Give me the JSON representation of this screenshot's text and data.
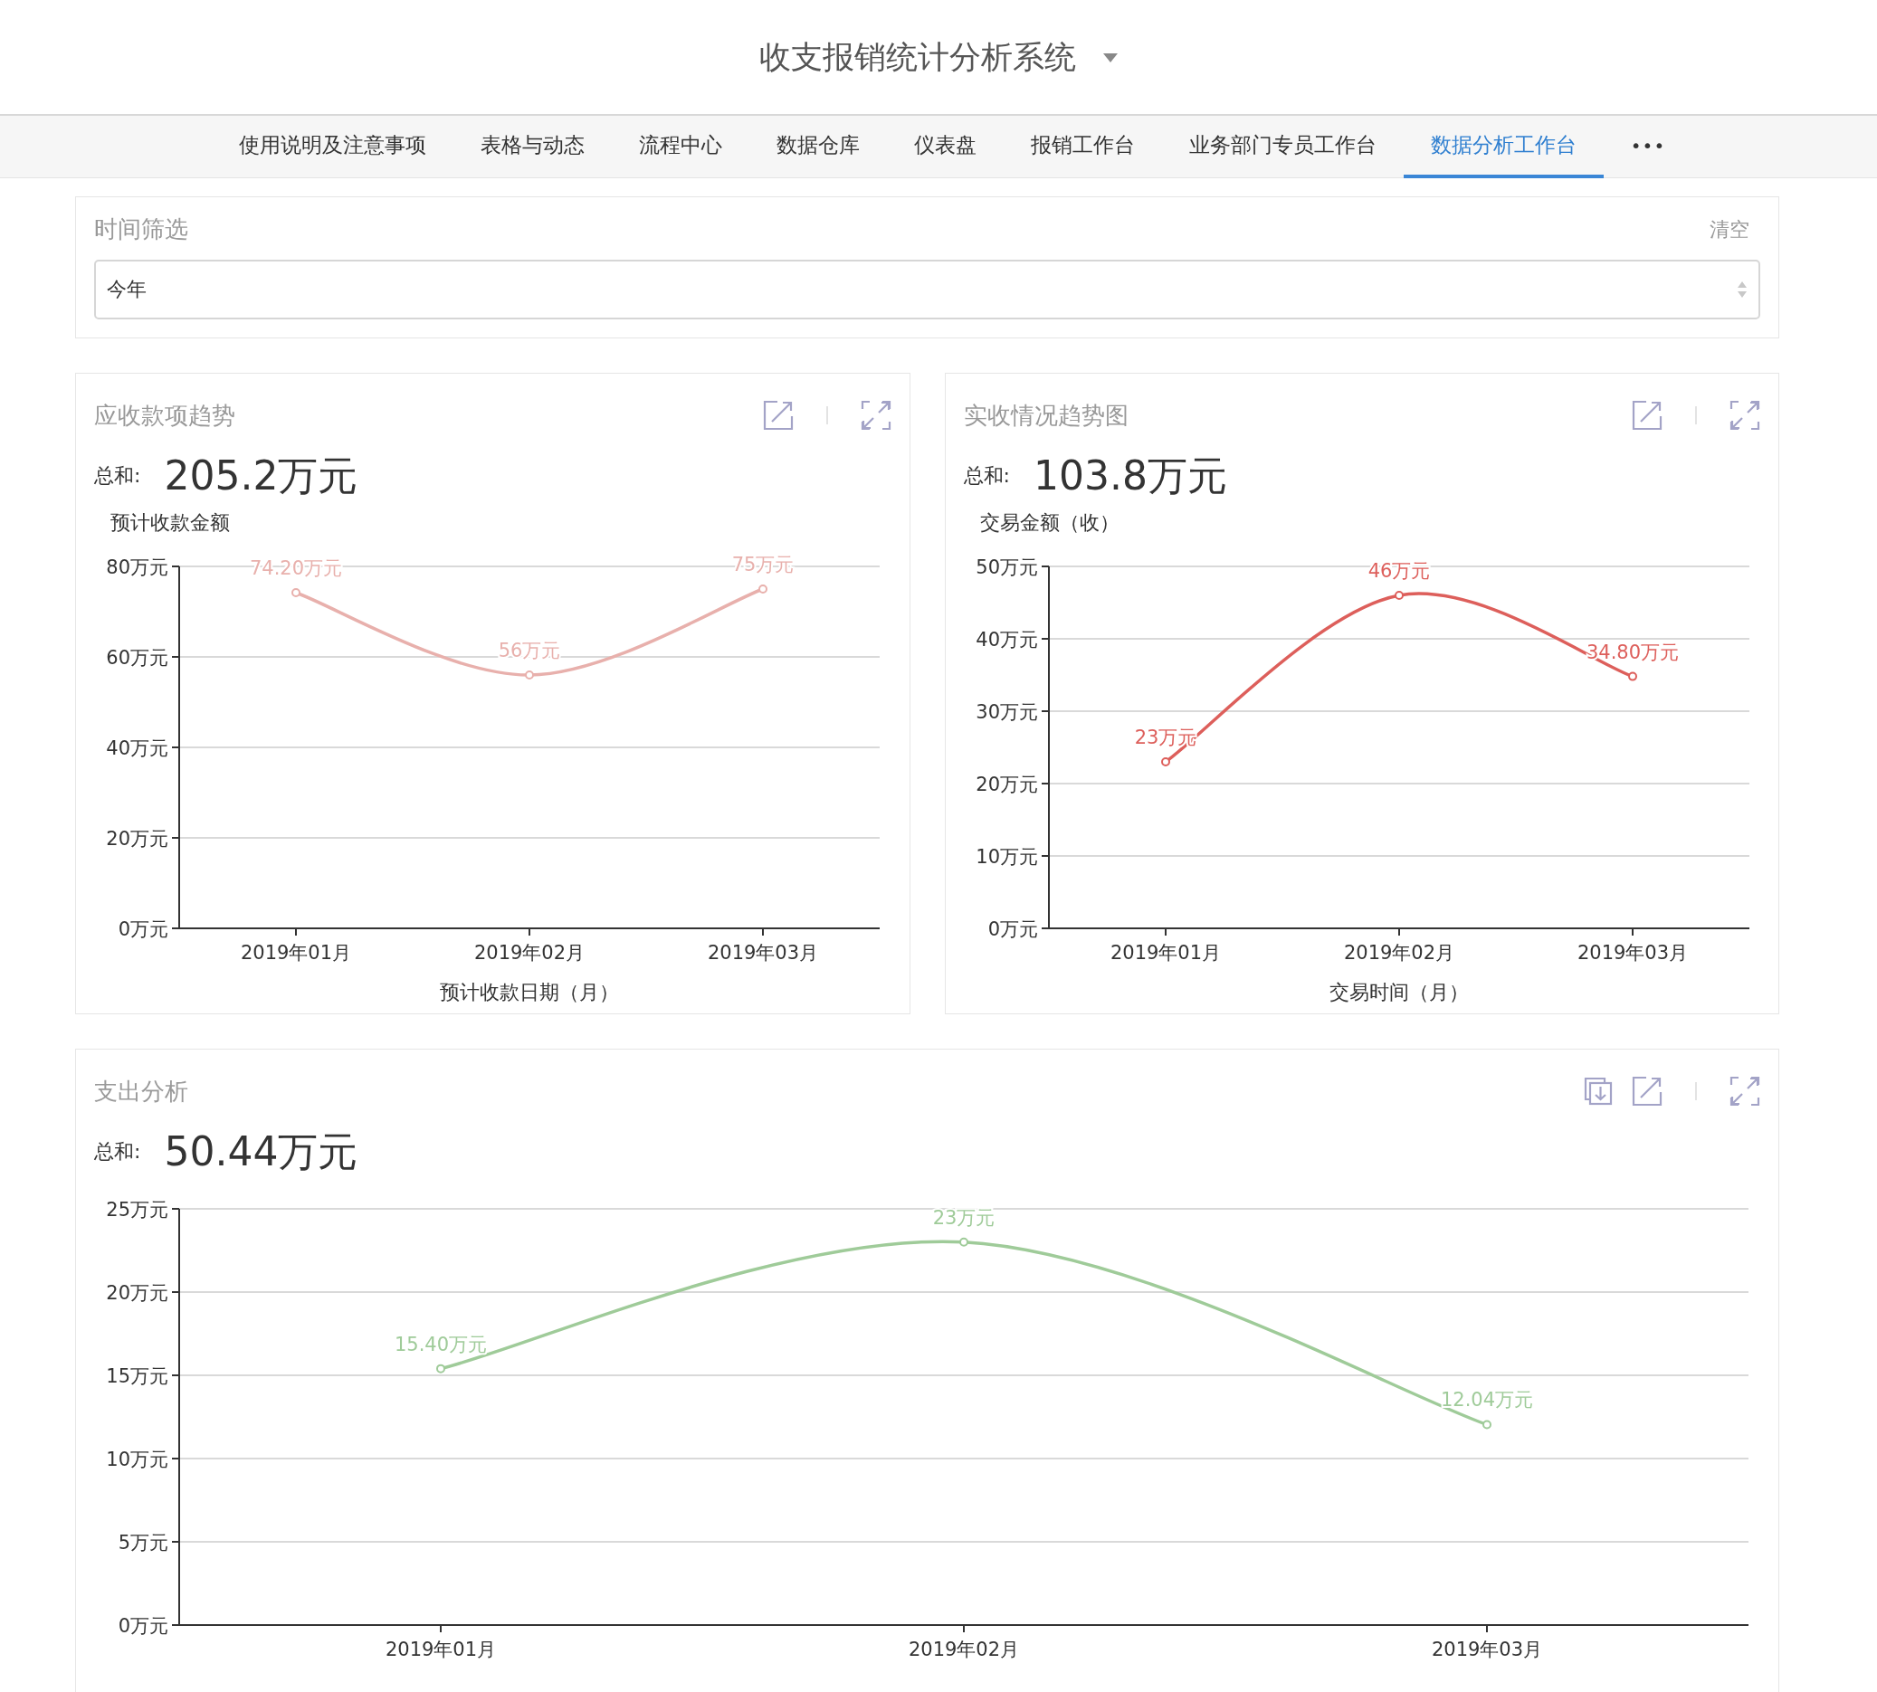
{
  "header": {
    "title": "收支报销统计分析系统"
  },
  "nav": {
    "tabs": [
      {
        "label": "使用说明及注意事项",
        "selected": false
      },
      {
        "label": "表格与动态",
        "selected": false
      },
      {
        "label": "流程中心",
        "selected": false
      },
      {
        "label": "数据仓库",
        "selected": false
      },
      {
        "label": "仪表盘",
        "selected": false
      },
      {
        "label": "报销工作台",
        "selected": false
      },
      {
        "label": "业务部门专员工作台",
        "selected": false
      },
      {
        "label": "数据分析工作台",
        "selected": true
      }
    ],
    "more": "•••"
  },
  "filter": {
    "title": "时间筛选",
    "clear": "清空",
    "value": "今年"
  },
  "panels": [
    {
      "title": "应收款项趋势",
      "wide": false,
      "download": false,
      "total_label": "总和:",
      "total": "205.2万元",
      "chart_data": {
        "type": "line",
        "ylabel": "预计收款金额",
        "xlabel": "预计收款日期（月）",
        "categories": [
          "2019年01月",
          "2019年02月",
          "2019年03月"
        ],
        "grid": true,
        "series": [
          {
            "color": "#e8b0ac",
            "marker": true,
            "values": [
              74.2,
              56,
              75
            ]
          }
        ],
        "value_labels": [
          "74.20万元",
          "56万元",
          "75万元"
        ],
        "ylim": [
          0,
          80
        ],
        "yticks": [
          {
            "value": 0,
            "label": "0万元"
          },
          {
            "value": 20,
            "label": "20万元"
          },
          {
            "value": 40,
            "label": "40万元"
          },
          {
            "value": 60,
            "label": "60万元"
          },
          {
            "value": 80,
            "label": "80万元"
          }
        ]
      }
    },
    {
      "title": "实收情况趋势图",
      "wide": false,
      "download": false,
      "total_label": "总和:",
      "total": "103.8万元",
      "chart_data": {
        "type": "line",
        "ylabel": "交易金额（收）",
        "xlabel": "交易时间（月）",
        "categories": [
          "2019年01月",
          "2019年02月",
          "2019年03月"
        ],
        "grid": true,
        "series": [
          {
            "color": "#dd5f5b",
            "marker": true,
            "values": [
              23,
              46,
              34.8
            ]
          }
        ],
        "value_labels": [
          "23万元",
          "46万元",
          "34.80万元"
        ],
        "ylim": [
          0,
          50
        ],
        "yticks": [
          {
            "value": 0,
            "label": "0万元"
          },
          {
            "value": 10,
            "label": "10万元"
          },
          {
            "value": 20,
            "label": "20万元"
          },
          {
            "value": 30,
            "label": "30万元"
          },
          {
            "value": 40,
            "label": "40万元"
          },
          {
            "value": 50,
            "label": "50万元"
          }
        ]
      }
    },
    {
      "title": "支出分析",
      "wide": true,
      "download": true,
      "total_label": "总和:",
      "total": "50.44万元",
      "chart_data": {
        "type": "line",
        "categories": [
          "2019年01月",
          "2019年02月",
          "2019年03月"
        ],
        "grid": true,
        "series": [
          {
            "color": "#9fcb99",
            "marker": true,
            "values": [
              15.4,
              23,
              12.04
            ]
          }
        ],
        "value_labels": [
          "15.40万元",
          "23万元",
          "12.04万元"
        ],
        "ylim": [
          0,
          25
        ],
        "yticks": [
          {
            "value": 0,
            "label": "0万元"
          },
          {
            "value": 5,
            "label": "5万元"
          },
          {
            "value": 10,
            "label": "10万元"
          },
          {
            "value": 15,
            "label": "15万元"
          },
          {
            "value": 20,
            "label": "20万元"
          },
          {
            "value": 25,
            "label": "25万元"
          }
        ]
      }
    }
  ]
}
